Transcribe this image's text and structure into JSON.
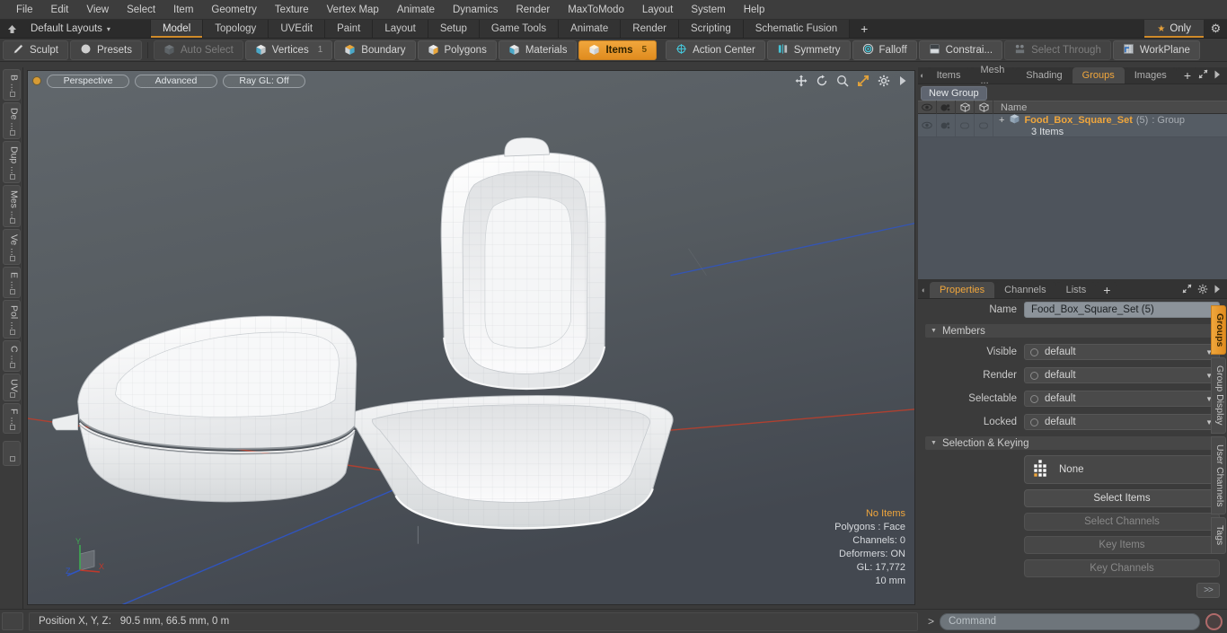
{
  "menu": {
    "items": [
      "File",
      "Edit",
      "View",
      "Select",
      "Item",
      "Geometry",
      "Texture",
      "Vertex Map",
      "Animate",
      "Dynamics",
      "Render",
      "MaxToModo",
      "Layout",
      "System",
      "Help"
    ]
  },
  "layoutbar": {
    "home_icon": "home-icon",
    "layout_name": "Default Layouts",
    "caret": "▾",
    "tabs": [
      {
        "label": "Model",
        "active": true
      },
      {
        "label": "Topology",
        "active": false
      },
      {
        "label": "UVEdit",
        "active": false
      },
      {
        "label": "Paint",
        "active": false
      },
      {
        "label": "Layout",
        "active": false
      },
      {
        "label": "Setup",
        "active": false
      },
      {
        "label": "Game Tools",
        "active": false
      },
      {
        "label": "Animate",
        "active": false
      },
      {
        "label": "Render",
        "active": false
      },
      {
        "label": "Scripting",
        "active": false
      },
      {
        "label": "Schematic Fusion",
        "active": false
      }
    ],
    "add_tab": "+",
    "only_label": "Only",
    "star_glyph": "★",
    "gear_glyph": "⚙"
  },
  "modebar": {
    "left": [
      {
        "label": "Sculpt",
        "icon": "pencil-icon",
        "state": "normal"
      },
      {
        "label": "Presets",
        "icon": "sphere-icon",
        "state": "normal"
      }
    ],
    "selection_modes": [
      {
        "label": "Auto Select",
        "icon": "cube-icon",
        "state": "dim",
        "badge": ""
      },
      {
        "label": "Vertices",
        "icon": "cube-icon",
        "state": "normal",
        "badge": "1"
      },
      {
        "label": "Boundary",
        "icon": "cube-icon",
        "state": "normal",
        "badge": ""
      },
      {
        "label": "Polygons",
        "icon": "cube-icon",
        "state": "normal",
        "badge": ""
      },
      {
        "label": "Materials",
        "icon": "cube-icon",
        "state": "normal",
        "badge": ""
      },
      {
        "label": "Items",
        "icon": "cube-icon",
        "state": "selected",
        "badge": "5"
      }
    ],
    "right": [
      {
        "label": "Action Center",
        "icon": "crosshair-icon",
        "state": "normal"
      },
      {
        "label": "Symmetry",
        "icon": "symmetry-icon",
        "state": "normal"
      },
      {
        "label": "Falloff",
        "icon": "falloff-icon",
        "state": "normal"
      },
      {
        "label": "Constrai...",
        "icon": "constraint-icon",
        "state": "normal"
      },
      {
        "label": "Select Through",
        "icon": "select-through-icon",
        "state": "dim"
      },
      {
        "label": "WorkPlane",
        "icon": "workplane-icon",
        "state": "normal"
      }
    ]
  },
  "left_toolbar": {
    "tabs": [
      "B ...",
      "De ...",
      "Dup ...",
      "Mes ...",
      "Ve ...",
      "E ...",
      "Pol ...",
      "C ...",
      "UV",
      "F ..."
    ]
  },
  "viewport": {
    "view_mode": "Perspective",
    "shading": "Advanced",
    "raygl": "Ray GL: Off",
    "icons": [
      "move-icon",
      "rotate-icon",
      "zoom-icon",
      "resize-icon",
      "gear-icon",
      "play-icon"
    ],
    "stats": {
      "selection": "No Items",
      "polygons": "Polygons : Face",
      "channels": "Channels: 0",
      "deformers": "Deformers: ON",
      "gl": "GL: 17,772",
      "scale": "10 mm"
    },
    "gizmo": {
      "x": "X",
      "y": "Y",
      "z": "Z"
    },
    "colors": {
      "x_axis": "#c0392b",
      "z_axis": "#2f55c4",
      "y_axis": "#4caf50",
      "bg_top": "#5d6368",
      "bg_bottom": "#474c51"
    }
  },
  "items_panel": {
    "tabs": [
      {
        "label": "Items",
        "active": false
      },
      {
        "label": "Mesh ...",
        "active": false
      },
      {
        "label": "Shading",
        "active": false
      },
      {
        "label": "Groups",
        "active": true
      },
      {
        "label": "Images",
        "active": false
      }
    ],
    "add_tab": "+",
    "new_group_button": "New Group",
    "columns": [
      {
        "name": "visible-column",
        "icon": "eye-icon"
      },
      {
        "name": "render-column",
        "icon": "render-icon"
      },
      {
        "name": "selectable-column",
        "icon": "item-outline-icon"
      },
      {
        "name": "lock-column",
        "icon": "item-outline-icon"
      },
      {
        "name": "name-column",
        "label": "Name"
      }
    ],
    "rows": [
      {
        "expander": "+",
        "icon": "group-icon",
        "name": "Food_Box_Square_Set",
        "count": "(5)",
        "type": ": Group",
        "sub": "3 Items"
      }
    ]
  },
  "properties_panel": {
    "tabs": [
      {
        "label": "Properties",
        "active": true
      },
      {
        "label": "Channels",
        "active": false
      },
      {
        "label": "Lists",
        "active": false
      }
    ],
    "add_tab": "+",
    "name_label": "Name",
    "name_value": "Food_Box_Square_Set (5)",
    "members_section": "Members",
    "members": [
      {
        "label": "Visible",
        "value": "default"
      },
      {
        "label": "Render",
        "value": "default"
      },
      {
        "label": "Selectable",
        "value": "default"
      },
      {
        "label": "Locked",
        "value": "default"
      }
    ],
    "selection_section": "Selection & Keying",
    "none_value": "None",
    "buttons": [
      {
        "label": "Select Items",
        "enabled": true
      },
      {
        "label": "Select Channels",
        "enabled": false
      },
      {
        "label": "Key Items",
        "enabled": false
      },
      {
        "label": "Key Channels",
        "enabled": false
      }
    ],
    "expand_button": ">>"
  },
  "right_vtabs": [
    {
      "label": "Groups",
      "active": true
    },
    {
      "label": "Group Display",
      "active": false
    },
    {
      "label": "User Channels",
      "active": false
    },
    {
      "label": "Tags",
      "active": false
    }
  ],
  "statusbar": {
    "position_label": "Position X, Y, Z:",
    "position_value": "90.5 mm, 66.5 mm, 0 m",
    "command_arrow": ">",
    "command_placeholder": "Command",
    "record_icon": "record-icon"
  }
}
